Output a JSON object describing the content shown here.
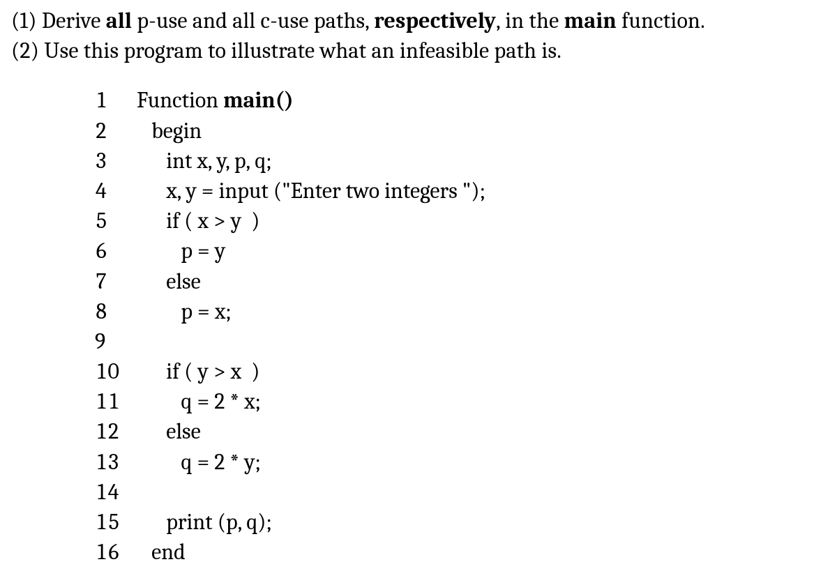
{
  "questions": {
    "q1": {
      "prefix": "(1) Derive ",
      "bold1": "all",
      "mid1": " p-use and all c-use paths, ",
      "bold2": "respectively",
      "mid2": ", in the ",
      "bold3": "main",
      "suffix": " function."
    },
    "q2": "(2) Use this program to illustrate what an infeasible path is."
  },
  "code": {
    "lines": [
      {
        "n": "1",
        "indent": 0,
        "segs": [
          {
            "t": "Function "
          },
          {
            "t": "main()",
            "b": true
          }
        ]
      },
      {
        "n": "2",
        "indent": 1,
        "segs": [
          {
            "t": "begin"
          }
        ]
      },
      {
        "n": "3",
        "indent": 2,
        "segs": [
          {
            "t": "int x, y, p, q;"
          }
        ]
      },
      {
        "n": "4",
        "indent": 2,
        "segs": [
          {
            "t": "x, y = input (\"Enter two integers \");"
          }
        ]
      },
      {
        "n": "5",
        "indent": 2,
        "segs": [
          {
            "t": "if ( x > y  )"
          }
        ]
      },
      {
        "n": "6",
        "indent": 3,
        "segs": [
          {
            "t": "p = y"
          }
        ]
      },
      {
        "n": "7",
        "indent": 2,
        "segs": [
          {
            "t": "else"
          }
        ]
      },
      {
        "n": "8",
        "indent": 3,
        "segs": [
          {
            "t": "p = x;"
          }
        ]
      },
      {
        "n": "9",
        "indent": 0,
        "segs": [
          {
            "t": ""
          }
        ]
      },
      {
        "n": "10",
        "indent": 2,
        "segs": [
          {
            "t": "if ( y > x  )"
          }
        ]
      },
      {
        "n": "11",
        "indent": 3,
        "segs": [
          {
            "t": "q = 2 * x;"
          }
        ]
      },
      {
        "n": "12",
        "indent": 2,
        "segs": [
          {
            "t": "else"
          }
        ]
      },
      {
        "n": "13",
        "indent": 3,
        "segs": [
          {
            "t": "q = 2 * y;"
          }
        ]
      },
      {
        "n": "14",
        "indent": 0,
        "segs": [
          {
            "t": ""
          }
        ]
      },
      {
        "n": "15",
        "indent": 2,
        "segs": [
          {
            "t": "print (p, q);"
          }
        ]
      },
      {
        "n": "16",
        "indent": 1,
        "segs": [
          {
            "t": "end"
          }
        ]
      }
    ],
    "indent_unit": "   "
  }
}
